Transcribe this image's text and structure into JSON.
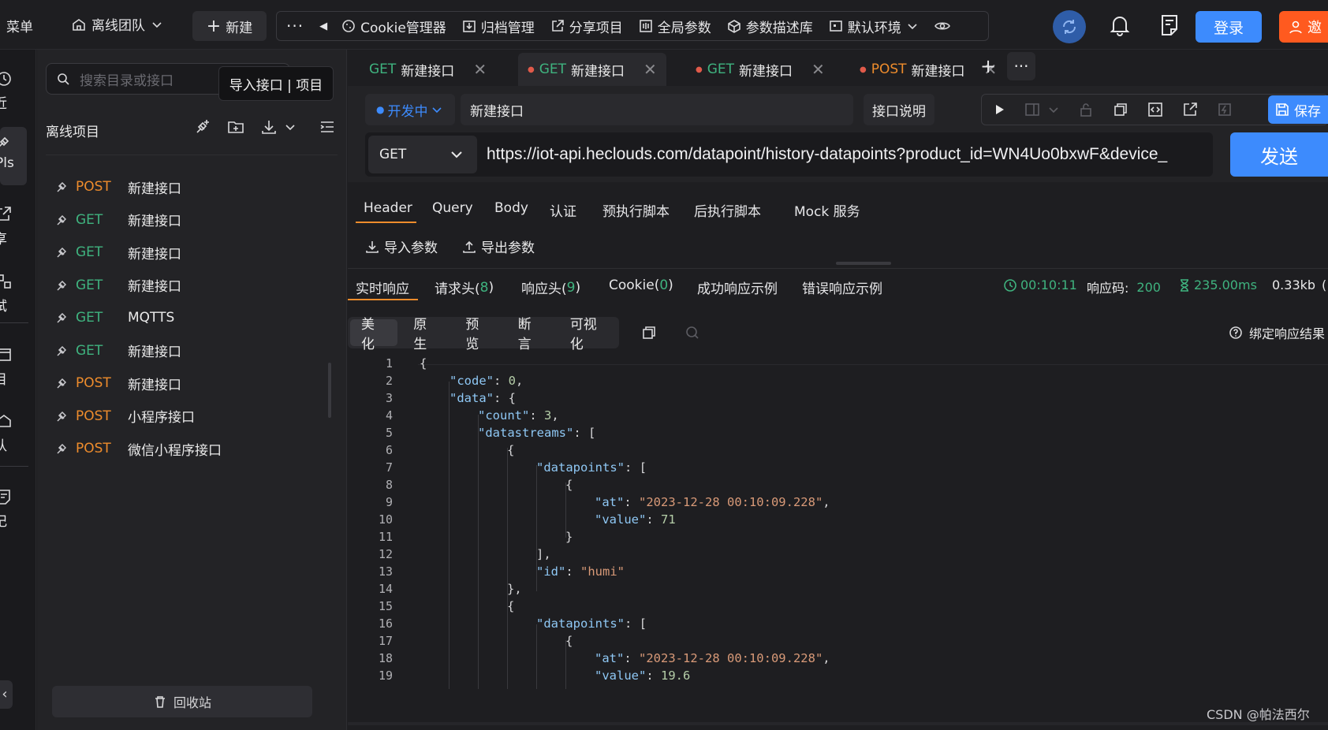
{
  "topbar": {
    "menu_label": "菜单",
    "team_label": "离线团队",
    "new_label": "新建",
    "items": [
      {
        "icon": "cookie-icon",
        "label": "Cookie管理器"
      },
      {
        "icon": "archive-icon",
        "label": "归档管理"
      },
      {
        "icon": "share-icon",
        "label": "分享项目"
      },
      {
        "icon": "params-icon",
        "label": "全局参数"
      },
      {
        "icon": "cube-icon",
        "label": "参数描述库"
      },
      {
        "icon": "env-icon",
        "label": "默认环境"
      }
    ],
    "login_label": "登录",
    "invite_label": "邀"
  },
  "rail": {
    "items": [
      {
        "label": "近",
        "icon": "clock-icon"
      },
      {
        "label": "Pls",
        "icon": "api-icon"
      },
      {
        "label": "享",
        "icon": "share-icon"
      },
      {
        "label": "试",
        "icon": "test-icon"
      },
      {
        "label": "目",
        "icon": "project-icon"
      },
      {
        "label": "队",
        "icon": "team-icon"
      },
      {
        "label": "记",
        "icon": "note-icon"
      }
    ]
  },
  "tree": {
    "search_placeholder": "搜索目录或接口",
    "tooltip": "导入接口 | 项目",
    "project_name": "离线项目",
    "items": [
      {
        "method": "POST",
        "name": "新建接口"
      },
      {
        "method": "GET",
        "name": "新建接口"
      },
      {
        "method": "GET",
        "name": "新建接口"
      },
      {
        "method": "GET",
        "name": "新建接口"
      },
      {
        "method": "GET",
        "name": "MQTTS"
      },
      {
        "method": "GET",
        "name": "新建接口"
      },
      {
        "method": "POST",
        "name": "新建接口"
      },
      {
        "method": "POST",
        "name": "小程序接口"
      },
      {
        "method": "POST",
        "name": "微信小程序接口"
      }
    ],
    "bottom_label": "回收站"
  },
  "tabs": [
    {
      "method": "GET",
      "name": "新建接口",
      "dot": false
    },
    {
      "method": "GET",
      "name": "新建接口",
      "dot": true,
      "active": true
    },
    {
      "method": "GET",
      "name": "新建接口",
      "dot": true
    },
    {
      "method": "POST",
      "name": "新建接口",
      "dot": true
    }
  ],
  "request": {
    "status_label": "开发中",
    "name_value": "新建接口",
    "doc_label": "接口说明",
    "save_label": "保存",
    "method": "GET",
    "url": "https://iot-api.heclouds.com/datapoint/history-datapoints?product_id=WN4Uo0bxwF&device_",
    "send_label": "发送"
  },
  "req_tabs": [
    "Header",
    "Query",
    "Body",
    "认证",
    "预执行脚本",
    "后执行脚本",
    "Mock 服务"
  ],
  "param_actions": {
    "import": "导入参数",
    "export": "导出参数"
  },
  "resp_tabs": {
    "realtime": "实时响应",
    "req_headers": "请求头(",
    "req_headers_count": "8",
    "resp_headers": "响应头(",
    "resp_headers_count": "9",
    "cookie": "Cookie(",
    "cookie_count": "0",
    "success_example": "成功响应示例",
    "error_example": "错误响应示例",
    "close_paren": ")"
  },
  "resp_meta": {
    "time": "00:10:11",
    "code_label": "响应码:",
    "code": "200",
    "duration": "235.00ms",
    "size": "0.33kb"
  },
  "view_tabs": [
    "美化",
    "原生",
    "预览",
    "断言",
    "可视化"
  ],
  "bind_result": "绑定响应结果",
  "watermark": "CSDN @帕法西尔",
  "code_lines": [
    "1",
    "2",
    "3",
    "4",
    "5",
    "6",
    "7",
    "8",
    "9",
    "10",
    "11",
    "12",
    "13",
    "14",
    "15",
    "16",
    "17",
    "18",
    "19"
  ],
  "json": {
    "code_key": "\"code\"",
    "code_val": "0",
    "data_key": "\"data\"",
    "count_key": "\"count\"",
    "count_val": "3",
    "ds_key": "\"datastreams\"",
    "dp_key": "\"datapoints\"",
    "at_key": "\"at\"",
    "at_val": "\"2023-12-28 00:10:09.228\"",
    "value_key": "\"value\"",
    "value1": "71",
    "value2": "19.6",
    "id_key": "\"id\"",
    "id_val": "\"humi\""
  },
  "colors": {
    "accent": "#3d8bfd",
    "get": "#3fb37f",
    "post": "#ee8c2c",
    "invite": "#ff5a1f",
    "status_green": "#3fb37f"
  }
}
